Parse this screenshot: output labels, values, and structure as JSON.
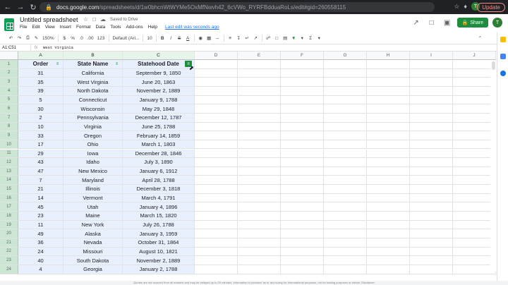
{
  "browser": {
    "url_host": "docs.google.com",
    "url_path": "/spreadsheets/d/1w0bhcnWtWYMe5OxMfNwvh42_6cVWo_RYRFBdduaRoLs/edit#gid=260558115",
    "avatar_letter": "T",
    "update_label": "Update"
  },
  "doc": {
    "title": "Untitled spreadsheet",
    "saved_status": "Saved to Drive",
    "menus": [
      "File",
      "Edit",
      "View",
      "Insert",
      "Format",
      "Data",
      "Tools",
      "Add-ons",
      "Help"
    ],
    "last_edit": "Last edit was seconds ago",
    "share_label": "Share",
    "avatar_letter": "T"
  },
  "toolbar": {
    "zoom": "150%",
    "currency": "$",
    "percent": "%",
    "dec_less": ".0",
    "dec_more": ".00",
    "more_formats": "123",
    "font": "Default (Ari...",
    "font_size": "10",
    "bold": "B",
    "italic": "I",
    "strike": "S",
    "text_color": "A"
  },
  "formula_bar": {
    "name_box": "A1:C51",
    "fx": "fx",
    "value": "West Virginia"
  },
  "columns": [
    "A",
    "B",
    "C",
    "D",
    "E",
    "F",
    "G",
    "H",
    "I",
    "J"
  ],
  "rows": [
    "1",
    "2",
    "3",
    "4",
    "5",
    "6",
    "7",
    "8",
    "9",
    "10",
    "11",
    "12",
    "13",
    "14",
    "15",
    "16",
    "17",
    "18",
    "19",
    "20",
    "21",
    "22",
    "23",
    "24"
  ],
  "table": {
    "headers": [
      "Order",
      "State Name",
      "Statehood Date"
    ],
    "data": [
      [
        "31",
        "California",
        "September 9, 1850"
      ],
      [
        "35",
        "West Virginia",
        "June 20, 1863"
      ],
      [
        "39",
        "North Dakota",
        "November 2, 1889"
      ],
      [
        "5",
        "Connecticut",
        "January 9, 1788"
      ],
      [
        "30",
        "Wisconsin",
        "May 29, 1848"
      ],
      [
        "2",
        "Pennsylvania",
        "December 12, 1787"
      ],
      [
        "10",
        "Virginia",
        "June 25, 1788"
      ],
      [
        "33",
        "Oregon",
        "February 14, 1859"
      ],
      [
        "17",
        "Ohio",
        "March 1, 1803"
      ],
      [
        "29",
        "Iowa",
        "December 28, 1846"
      ],
      [
        "43",
        "Idaho",
        "July 3, 1890"
      ],
      [
        "47",
        "New Mexico",
        "January 6, 1912"
      ],
      [
        "7",
        "Maryland",
        "April 28, 1788"
      ],
      [
        "21",
        "Illinois",
        "December 3, 1818"
      ],
      [
        "14",
        "Vermont",
        "March 4, 1791"
      ],
      [
        "45",
        "Utah",
        "January 4, 1896"
      ],
      [
        "23",
        "Maine",
        "March 15, 1820"
      ],
      [
        "11",
        "New York",
        "July 26, 1788"
      ],
      [
        "49",
        "Alaska",
        "January 3, 1959"
      ],
      [
        "36",
        "Nevada",
        "October 31, 1864"
      ],
      [
        "24",
        "Missouri",
        "August 10, 1821"
      ],
      [
        "40",
        "South Dakota",
        "November 2, 1889"
      ],
      [
        "4",
        "Georgia",
        "January 2, 1788"
      ]
    ]
  },
  "footer_text": "Quotes are not sourced from all markets and may be delayed up to 20 minutes. Information is provided 'as is' and solely for informational purposes, not for trading purposes or advice. Disclaimer"
}
